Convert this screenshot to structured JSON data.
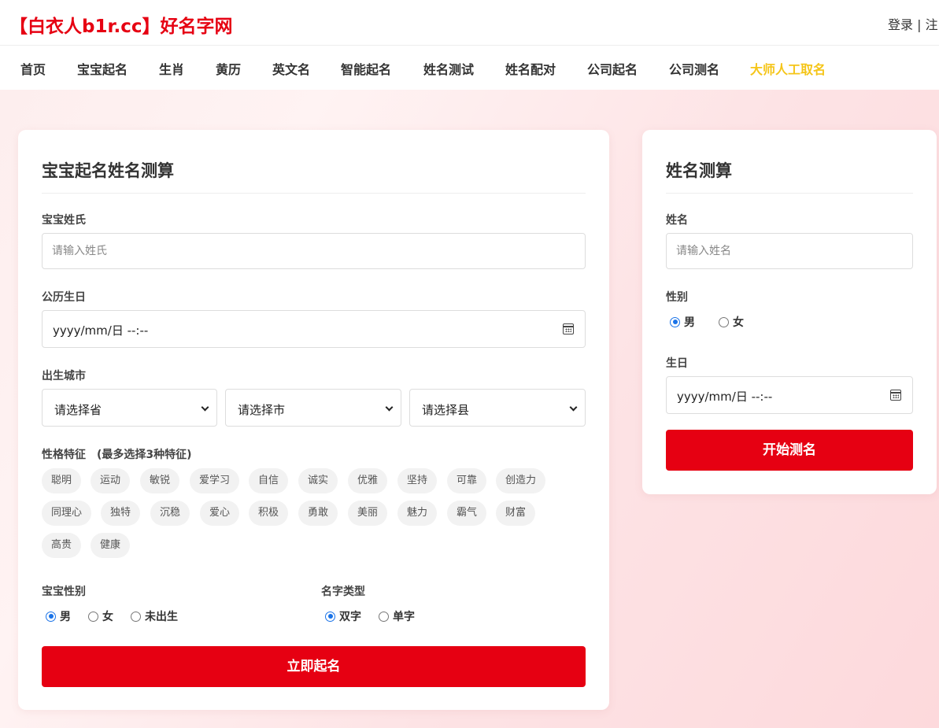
{
  "header": {
    "logo": "【白衣人b1r.cc】好名字网",
    "login": "登录",
    "separator": "|",
    "register": "注"
  },
  "nav": {
    "items": [
      "首页",
      "宝宝起名",
      "生肖",
      "黄历",
      "英文名",
      "智能起名",
      "姓名测试",
      "姓名配对",
      "公司起名",
      "公司测名",
      "大师人工取名"
    ],
    "highlight_color": "#f5c518"
  },
  "left_form": {
    "title": "宝宝起名姓名测算",
    "surname_label": "宝宝姓氏",
    "surname_placeholder": "请输入姓氏",
    "birthday_label": "公历生日",
    "birthday_value": "yyyy/mm/日  --:--",
    "city_label": "出生城市",
    "province": "请选择省",
    "city": "请选择市",
    "county": "请选择县",
    "traits_label": "性格特征　(最多选择3种特征)",
    "traits": [
      "聪明",
      "运动",
      "敏锐",
      "爱学习",
      "自信",
      "诚实",
      "优雅",
      "坚持",
      "可靠",
      "创造力",
      "同理心",
      "独特",
      "沉稳",
      "爱心",
      "积极",
      "勇敢",
      "美丽",
      "魅力",
      "霸气",
      "财富",
      "高贵",
      "健康"
    ],
    "gender_label": "宝宝性别",
    "gender_options": [
      "男",
      "女",
      "未出生"
    ],
    "gender_selected": "男",
    "name_type_label": "名字类型",
    "name_type_options": [
      "双字",
      "单字"
    ],
    "name_type_selected": "双字",
    "submit_label": "立即起名"
  },
  "right_form": {
    "title": "姓名测算",
    "name_label": "姓名",
    "name_placeholder": "请输入姓名",
    "gender_label": "性别",
    "gender_options": [
      "男",
      "女"
    ],
    "gender_selected": "男",
    "birthday_label": "生日",
    "birthday_value": "yyyy/mm/日  --:--",
    "submit_label": "开始测名"
  },
  "colors": {
    "brand_red": "#e60012",
    "radio_blue": "#1a73e8"
  }
}
